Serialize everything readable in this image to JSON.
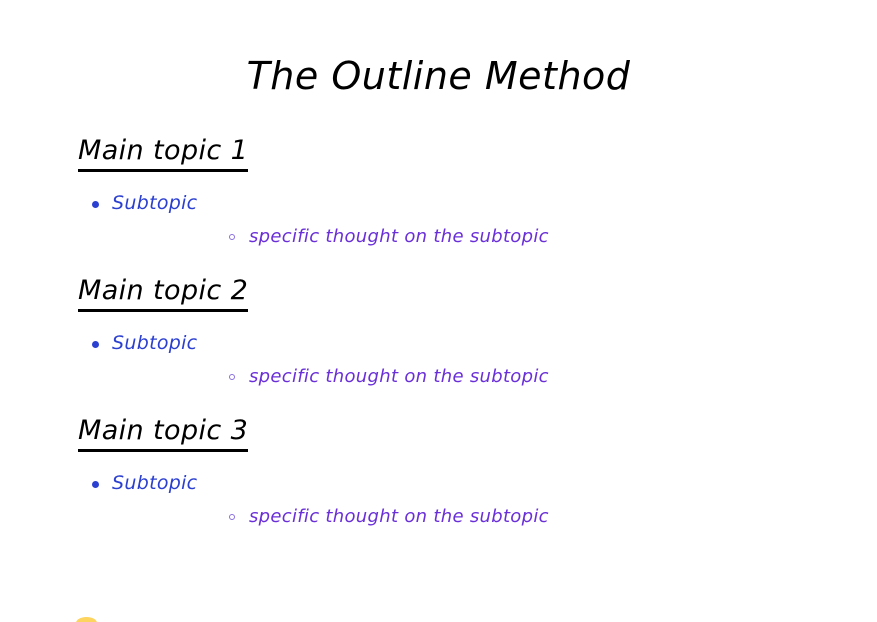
{
  "document": {
    "title": "The Outline Method",
    "background_color": "#ffffff",
    "title_color": "#000000",
    "heading_color": "#000000",
    "subtopic_color": "#2b3fd0",
    "detail_color": "#6a2fd8",
    "accent_color": "#fdd45e"
  },
  "outline": {
    "groups": [
      {
        "heading": "Main topic 1",
        "subtopics": [
          {
            "label": "Subtopic",
            "details": [
              {
                "label": "specific thought on the subtopic"
              }
            ]
          }
        ]
      },
      {
        "heading": "Main topic 2",
        "subtopics": [
          {
            "label": "Subtopic",
            "details": [
              {
                "label": "specific thought on the subtopic"
              }
            ]
          }
        ]
      },
      {
        "heading": "Main topic 3",
        "subtopics": [
          {
            "label": "Subtopic",
            "details": [
              {
                "label": "specific thought on the subtopic"
              }
            ]
          }
        ]
      }
    ]
  }
}
